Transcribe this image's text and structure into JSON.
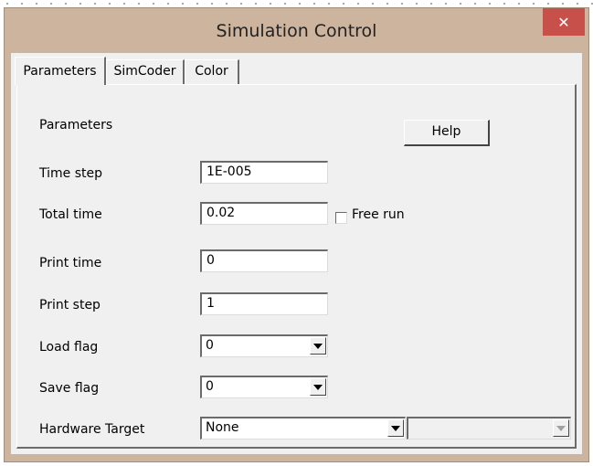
{
  "window": {
    "title": "Simulation Control",
    "close_glyph": "✕"
  },
  "tabs": [
    {
      "label": "Parameters",
      "active": true
    },
    {
      "label": "SimCoder",
      "active": false
    },
    {
      "label": "Color",
      "active": false
    }
  ],
  "panel": {
    "heading": "Parameters",
    "help_label": "Help",
    "fields": {
      "time_step": {
        "label": "Time step",
        "value": "1E-005"
      },
      "total_time": {
        "label": "Total time",
        "value": "0.02"
      },
      "free_run": {
        "label": "Free run",
        "checked": false
      },
      "print_time": {
        "label": "Print time",
        "value": "0"
      },
      "print_step": {
        "label": "Print step",
        "value": "1"
      },
      "load_flag": {
        "label": "Load flag",
        "value": "0"
      },
      "save_flag": {
        "label": "Save flag",
        "value": "0"
      },
      "hardware_target": {
        "label": "Hardware Target",
        "value": "None",
        "secondary_value": ""
      }
    }
  },
  "colors": {
    "title_bar": "#cdb49e",
    "close_button": "#c7504a",
    "dialog_face": "#f0f0f0"
  },
  "icons": {
    "close": "close-icon",
    "dropdown": "chevron-down-icon"
  }
}
